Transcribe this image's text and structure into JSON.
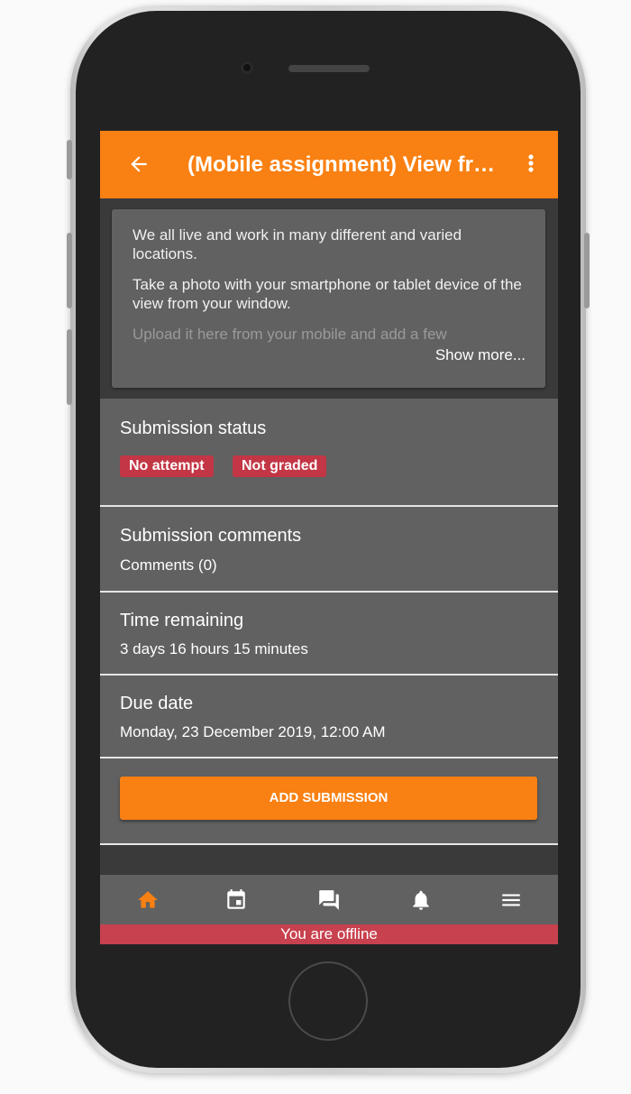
{
  "appbar": {
    "title": "(Mobile assignment) View from your window",
    "back_icon": "arrow-back-icon",
    "more_icon": "more-vertical-icon"
  },
  "description": {
    "paragraphs": [
      "We all live and work in many different and varied locations.",
      "Take a photo with your smartphone or tablet device of the view from your window.",
      "Upload it here from your mobile and add a few"
    ],
    "show_more": "Show more..."
  },
  "submission_status": {
    "title": "Submission status",
    "badges": [
      "No attempt",
      "Not graded"
    ]
  },
  "submission_comments": {
    "title": "Submission comments",
    "value": "Comments (0)"
  },
  "time_remaining": {
    "title": "Time remaining",
    "value": "3 days 16 hours 15 minutes"
  },
  "due_date": {
    "title": "Due date",
    "value": "Monday, 23 December 2019, 12:00 AM"
  },
  "add_submission_label": "ADD SUBMISSION",
  "tabs": [
    {
      "icon": "home-icon",
      "active": true
    },
    {
      "icon": "calendar-icon",
      "active": false
    },
    {
      "icon": "messages-icon",
      "active": false
    },
    {
      "icon": "bell-icon",
      "active": false
    },
    {
      "icon": "menu-icon",
      "active": false
    }
  ],
  "offline_message": "You are offline",
  "colors": {
    "accent": "#f98012",
    "danger": "#c23645",
    "panel": "#616161",
    "background": "#3a3a3a"
  }
}
